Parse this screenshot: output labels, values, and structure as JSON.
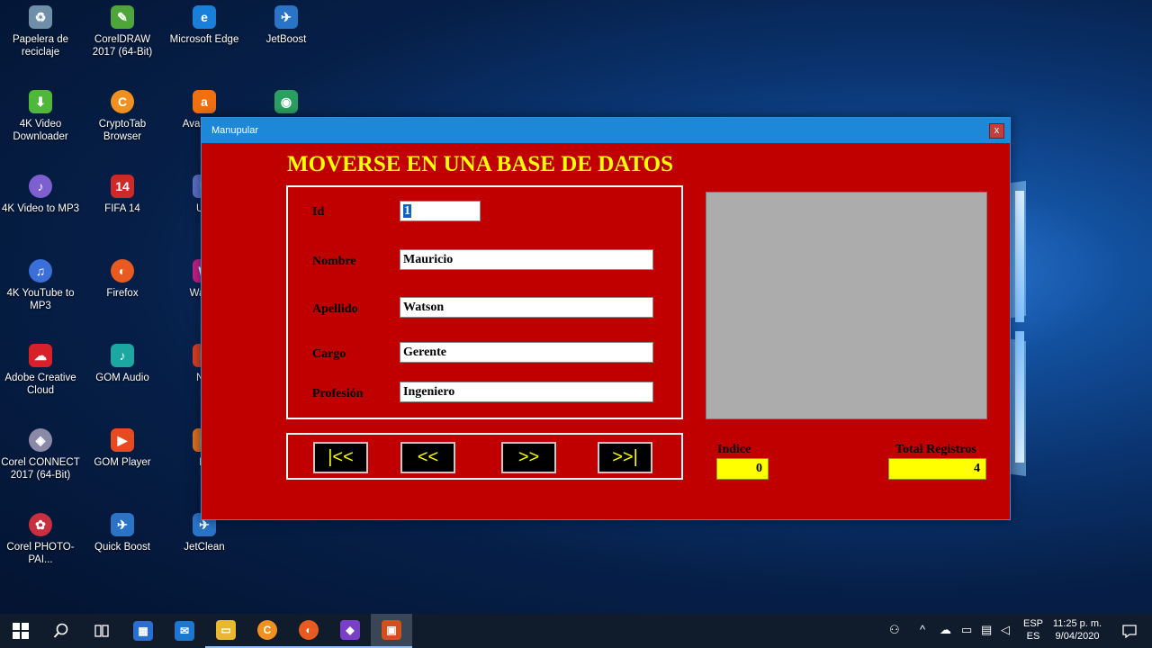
{
  "desktop": {
    "icons": [
      {
        "label": "Papelera de reciclaje",
        "icon": "recycle-bin-icon",
        "color": "#6f8fa8",
        "glyph": "♻"
      },
      {
        "label": "CorelDRAW 2017 (64-Bit)",
        "icon": "coreldraw-icon",
        "color": "#4ea53a",
        "glyph": "✎"
      },
      {
        "label": "Microsoft Edge",
        "icon": "edge-icon",
        "color": "#1a7fd8",
        "glyph": "e"
      },
      {
        "label": "JetBoost",
        "icon": "jetboost-icon",
        "color": "#2a74c8",
        "glyph": "✈"
      },
      {
        "label": "4K Video Downloader",
        "icon": "4k-video-downloader-icon",
        "color": "#4fb83a",
        "glyph": "⬇"
      },
      {
        "label": "CryptoTab Browser",
        "icon": "cryptotab-icon",
        "color": "#f09020",
        "glyph": "C"
      },
      {
        "label": "Avast Ant",
        "icon": "avast-icon",
        "color": "#f07010",
        "glyph": "a"
      },
      {
        "label": "",
        "icon": "app-globe-icon",
        "color": "#2aa060",
        "glyph": "◉"
      },
      {
        "label": "4K Video to MP3",
        "icon": "4k-video-to-mp3-icon",
        "color": "#7d5fd0",
        "glyph": "♪"
      },
      {
        "label": "FIFA 14",
        "icon": "fifa-icon",
        "color": "#d02828",
        "glyph": "14"
      },
      {
        "label": "Ultr",
        "icon": "ultra-icon",
        "color": "#5a6fc8",
        "glyph": "U"
      },
      {
        "label": "4K YouTube to MP3",
        "icon": "4k-youtube-to-mp3-icon",
        "color": "#3a6fd8",
        "glyph": "♫"
      },
      {
        "label": "Firefox",
        "icon": "firefox-icon",
        "color": "#e85a20",
        "glyph": "◐"
      },
      {
        "label": "Wamp",
        "icon": "wamp-icon",
        "color": "#c0208a",
        "glyph": "W"
      },
      {
        "label": "Adobe Creative Cloud",
        "icon": "creative-cloud-icon",
        "color": "#d8202a",
        "glyph": "☁"
      },
      {
        "label": "GOM Audio",
        "icon": "gom-audio-icon",
        "color": "#1aa8a0",
        "glyph": "♪"
      },
      {
        "label": "Nitr",
        "icon": "nitro-icon",
        "color": "#d84020",
        "glyph": "N"
      },
      {
        "label": "Corel CONNECT 2017 (64-Bit)",
        "icon": "corel-connect-icon",
        "color": "#8a8aa8",
        "glyph": "◈"
      },
      {
        "label": "GOM Player",
        "icon": "gom-player-icon",
        "color": "#e84a20",
        "glyph": "▶"
      },
      {
        "label": "Br",
        "icon": "br-icon",
        "color": "#d87020",
        "glyph": "B"
      },
      {
        "label": "Corel PHOTO-PAI...",
        "icon": "corel-photopaint-icon",
        "color": "#c83040",
        "glyph": "✿"
      },
      {
        "label": "Quick Boost",
        "icon": "quick-boost-icon",
        "color": "#2a74c8",
        "glyph": "✈"
      },
      {
        "label": "JetClean",
        "icon": "jetclean-icon",
        "color": "#2a74c8",
        "glyph": "✈"
      }
    ]
  },
  "window": {
    "title": "Manupular",
    "close_label": "x",
    "heading": "MOVERSE EN UNA BASE DE DATOS",
    "fields": [
      {
        "label": "Id",
        "value": "1"
      },
      {
        "label": "Nombre",
        "value": "Mauricio"
      },
      {
        "label": "Apellido",
        "value": "Watson"
      },
      {
        "label": "Cargo",
        "value": "Gerente"
      },
      {
        "label": "Profesión",
        "value": "Ingeniero"
      }
    ],
    "nav": {
      "first": "|<<",
      "prev": "<<",
      "next": ">>",
      "last": ">>|"
    },
    "indice_label": "Indice",
    "indice_value": "0",
    "total_label": "Total Registros",
    "total_value": "4",
    "colors": {
      "background": "#c00000",
      "heading": "#ffff00",
      "stat_box": "#ffff00",
      "photo_box": "#acacac"
    }
  },
  "taskbar": {
    "items": [
      {
        "icon": "start-windows-icon"
      },
      {
        "icon": "search-icon"
      },
      {
        "icon": "task-view-icon"
      },
      {
        "icon": "store-icon"
      },
      {
        "icon": "mail-icon"
      },
      {
        "icon": "file-explorer-icon"
      },
      {
        "icon": "cryptotab-icon"
      },
      {
        "icon": "firefox-icon"
      },
      {
        "icon": "visual-studio-icon"
      },
      {
        "icon": "running-app-icon"
      }
    ],
    "language_top": "ESP",
    "language_bottom": "ES",
    "time": "11:25 p. m.",
    "date": "9/04/2020"
  }
}
